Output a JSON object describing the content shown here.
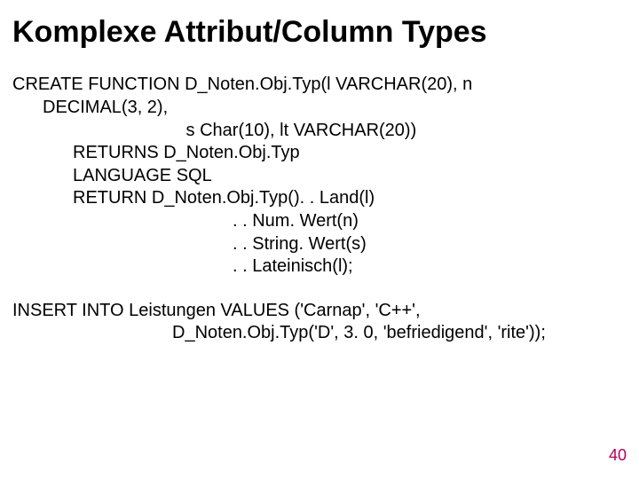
{
  "title": "Komplexe Attribut/Column Types",
  "code": {
    "l01": "CREATE FUNCTION D_Noten.Obj.Typ(l VARCHAR(20), n",
    "l02": "DECIMAL(3, 2),",
    "l03": " s Char(10), lt VARCHAR(20))",
    "l04": "RETURNS D_Noten.Obj.Typ",
    "l05": "LANGUAGE SQL",
    "l06": "RETURN D_Noten.Obj.Typ(). . Land(l)",
    "l07": ". . Num. Wert(n)",
    "l08": ". . String. Wert(s)",
    "l09": ". . Lateinisch(l);",
    "l10": "INSERT INTO Leistungen VALUES ('Carnap', 'C++',",
    "l11": "D_Noten.Obj.Typ('D', 3. 0, 'befriedigend', 'rite'));"
  },
  "page_number": "40"
}
